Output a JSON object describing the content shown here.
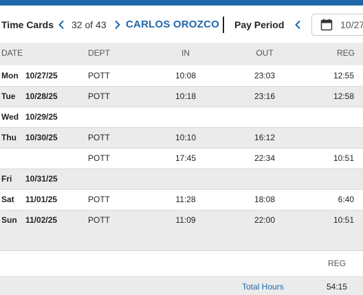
{
  "header": {
    "title": "Time Cards",
    "counter": "32 of 43",
    "employee_name": "CARLOS OROZCO",
    "pay_period_label": "Pay Period",
    "date_value": "10/27",
    "prev_icon": "chevron-left-icon",
    "next_icon": "chevron-right-icon",
    "calendar_icon": "calendar-icon"
  },
  "colors": {
    "accent": "#1e67a8",
    "row_gray": "#ebebeb"
  },
  "table": {
    "columns": [
      "DATE",
      "DEPT",
      "IN",
      "OUT",
      "REG"
    ],
    "rows": [
      {
        "day": "Mon",
        "date": "10/27/25",
        "dept": "POTT",
        "in": "10:08",
        "out": "23:03",
        "reg": "12:55"
      },
      {
        "day": "Tue",
        "date": "10/28/25",
        "dept": "POTT",
        "in": "10:18",
        "out": "23:16",
        "reg": "12:58"
      },
      {
        "day": "Wed",
        "date": "10/29/25",
        "dept": "",
        "in": "",
        "out": "",
        "reg": ""
      },
      {
        "day": "Thu",
        "date": "10/30/25",
        "dept": "POTT",
        "in": "10:10",
        "out": "16:12",
        "reg": ""
      },
      {
        "day": "",
        "date": "",
        "dept": "POTT",
        "in": "17:45",
        "out": "22:34",
        "reg": "10:51"
      },
      {
        "day": "Fri",
        "date": "10/31/25",
        "dept": "",
        "in": "",
        "out": "",
        "reg": ""
      },
      {
        "day": "Sat",
        "date": "11/01/25",
        "dept": "POTT",
        "in": "11:28",
        "out": "18:08",
        "reg": "6:40"
      },
      {
        "day": "Sun",
        "date": "11/02/25",
        "dept": "POTT",
        "in": "11:09",
        "out": "22:00",
        "reg": "10:51"
      }
    ]
  },
  "summary": {
    "reg_label": "REG",
    "total_label": "Total Hours",
    "total_value": "54:15"
  }
}
